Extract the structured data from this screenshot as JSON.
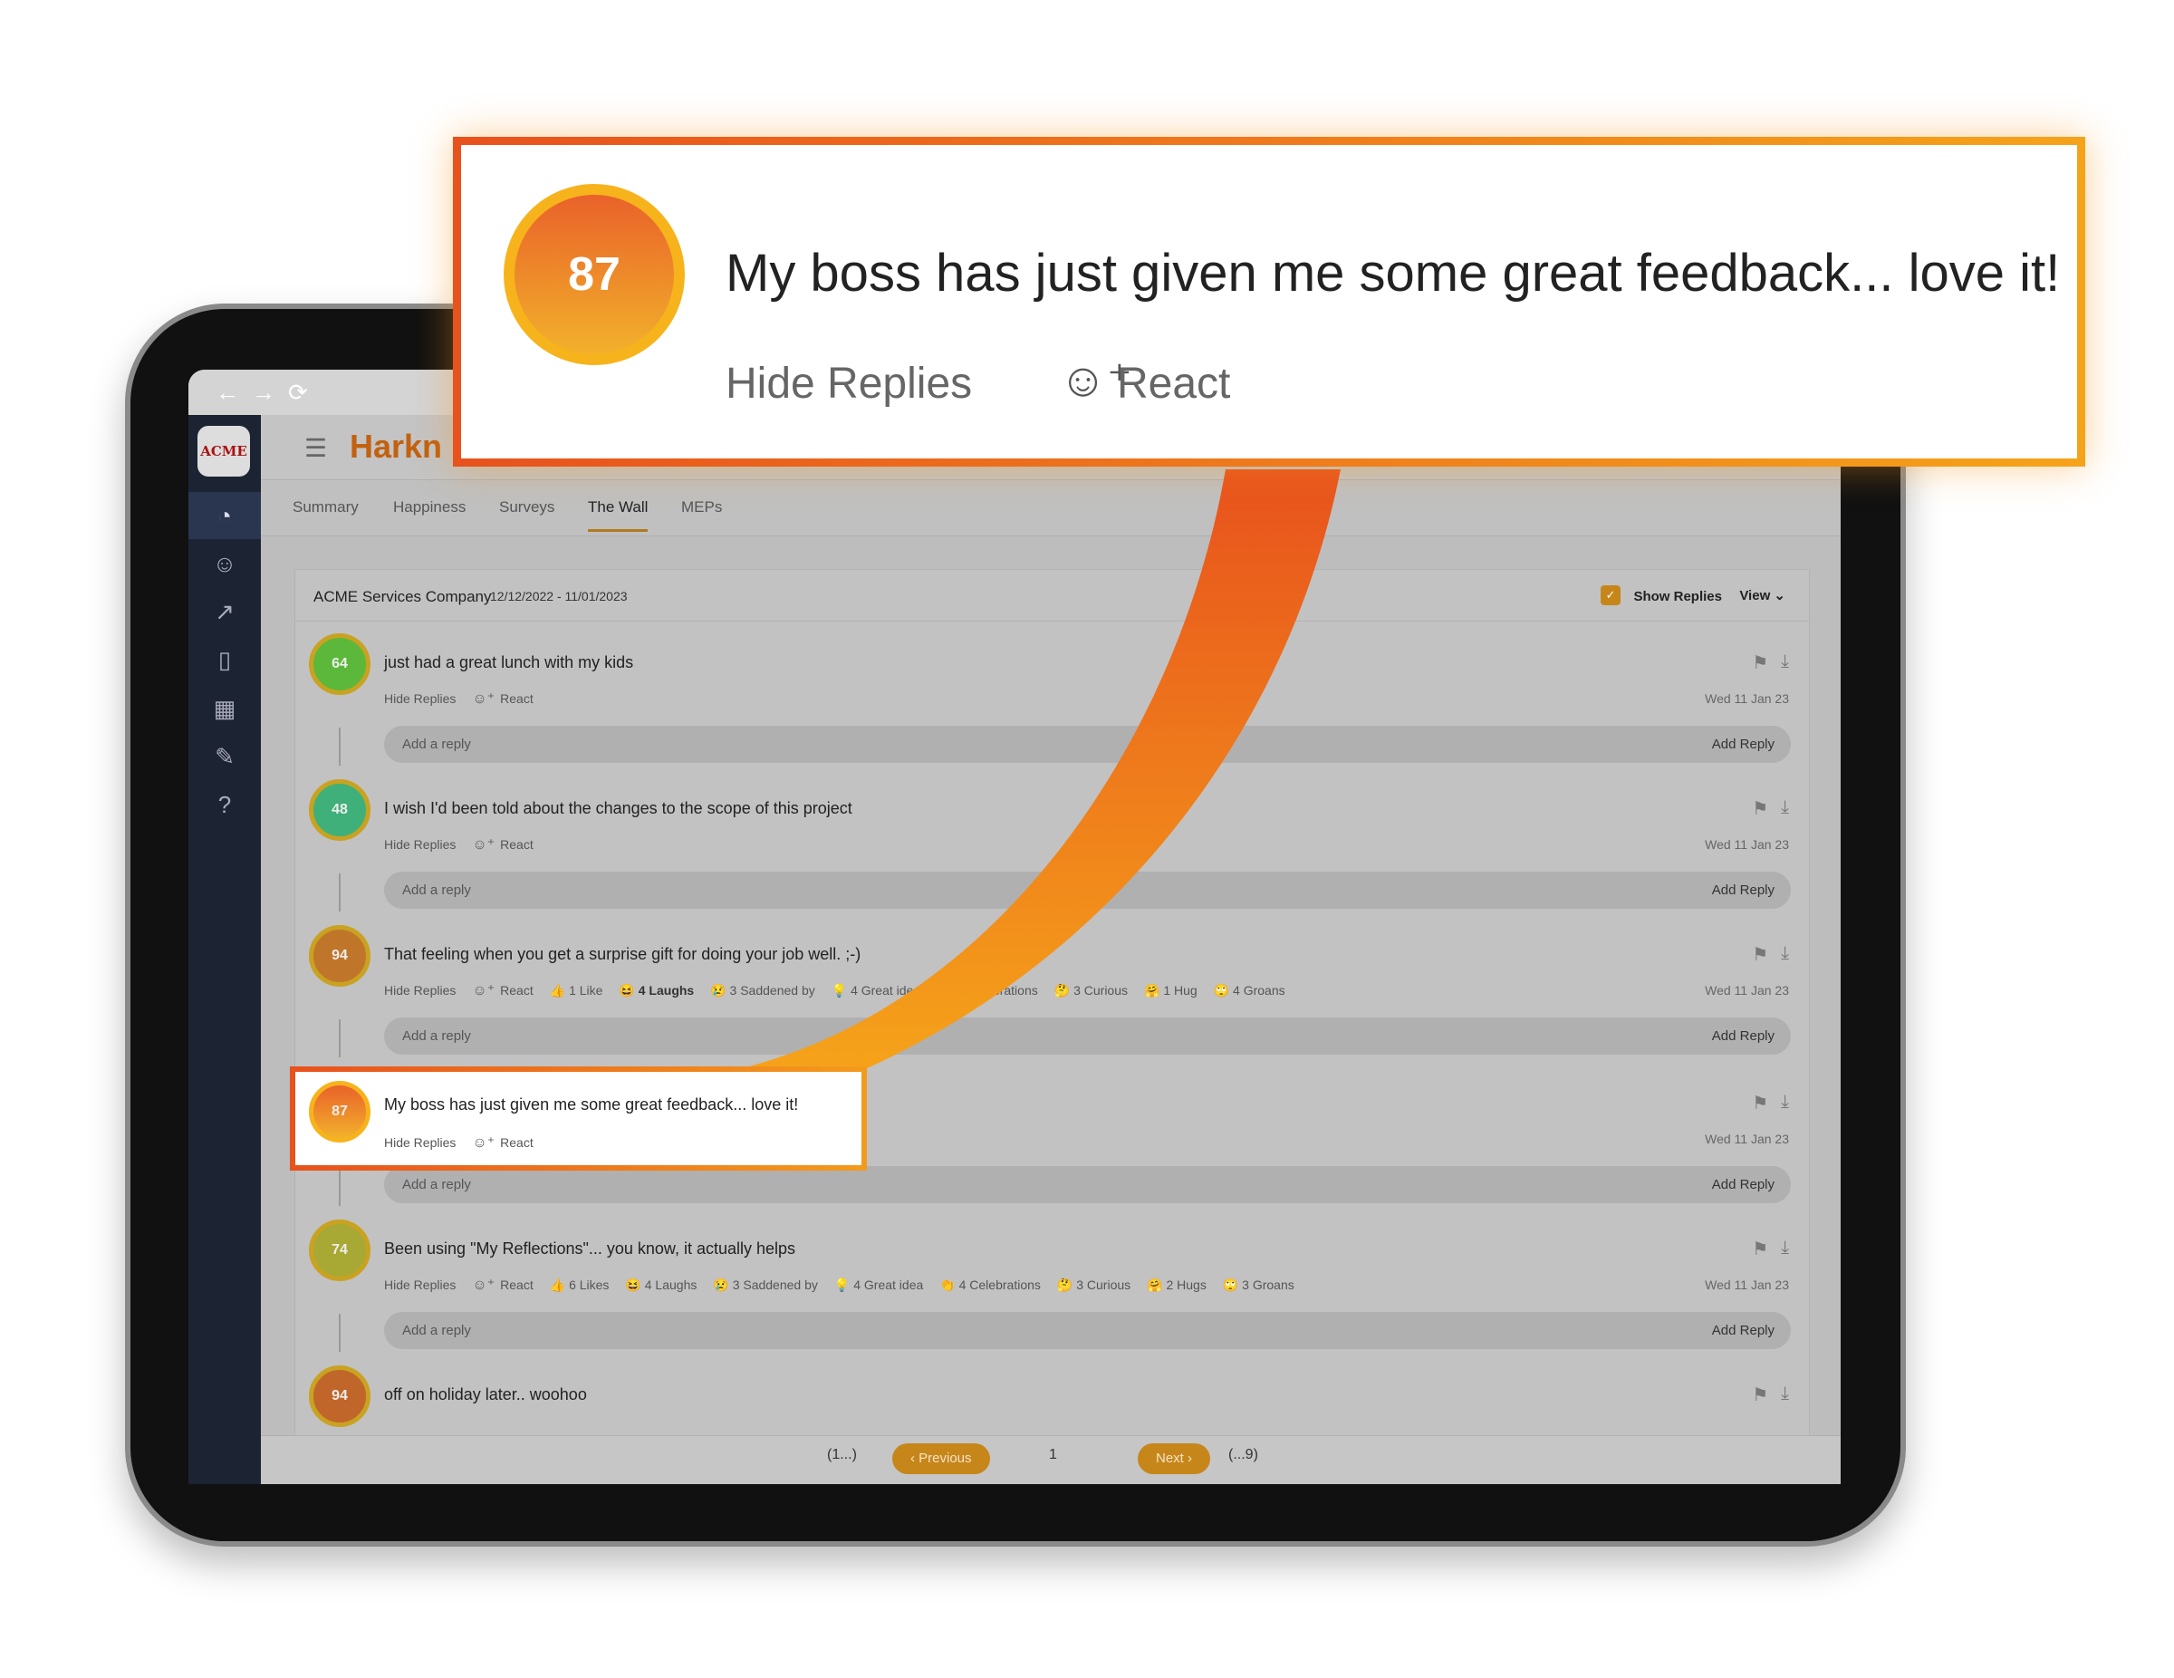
{
  "browser": {
    "back": "←",
    "forward": "→",
    "reload": "⟳"
  },
  "app": {
    "logo": "ACME",
    "brand": "Harkn"
  },
  "sidebar": {
    "icons": [
      "dashboard-icon",
      "chat-icon",
      "trend-icon",
      "book-icon",
      "org-chart-icon",
      "tools-icon",
      "help-icon"
    ]
  },
  "tabs": [
    {
      "label": "Summary"
    },
    {
      "label": "Happiness"
    },
    {
      "label": "Surveys"
    },
    {
      "label": "The Wall",
      "active": true
    },
    {
      "label": "MEPs"
    }
  ],
  "wall": {
    "company": "ACME Services Company",
    "date_range": "12/12/2022 - 11/01/2023",
    "show_replies_label": "Show Replies",
    "show_replies_checked": true,
    "view_label": "View",
    "posts": [
      {
        "score": "64",
        "text": "just had a great lunch with my kids",
        "hide": "Hide Replies",
        "react": "React",
        "date": "Wed 11 Jan 23",
        "reply_placeholder": "Add a reply",
        "reply_button": "Add Reply",
        "color": "#5cb83a",
        "reactions": []
      },
      {
        "score": "48",
        "text": "I wish I'd been told about the changes to the scope of this project",
        "hide": "Hide Replies",
        "react": "React",
        "date": "Wed 11 Jan 23",
        "reply_placeholder": "Add a reply",
        "reply_button": "Add Reply",
        "color": "#3fb07a",
        "reactions": []
      },
      {
        "score": "94",
        "text": "That feeling when you get a surprise gift for doing your job well. ;-)",
        "hide": "Hide Replies",
        "react": "React",
        "date": "Wed 11 Jan 23",
        "reply_placeholder": "Add a reply",
        "reply_button": "Add Reply",
        "color": "#c0762a",
        "reactions": [
          {
            "icon": "👍",
            "label": "1 Like"
          },
          {
            "icon": "😆",
            "label": "4 Laughs",
            "bold": true
          },
          {
            "icon": "😢",
            "label": "3 Saddened by"
          },
          {
            "icon": "💡",
            "label": "4 Great idea"
          },
          {
            "icon": "👏",
            "label": "4 Celebrations"
          },
          {
            "icon": "🤔",
            "label": "3 Curious"
          },
          {
            "icon": "🤗",
            "label": "1 Hug"
          },
          {
            "icon": "🙄",
            "label": "4 Groans"
          }
        ]
      },
      {
        "score": "87",
        "text": "My boss has just given me some great feedback... love it!",
        "hide": "Hide Replies",
        "react": "React",
        "date": "Wed 11 Jan 23",
        "reply_placeholder": "Add a reply",
        "reply_button": "Add Reply",
        "color": "#e8843a",
        "highlighted": true,
        "reactions": []
      },
      {
        "score": "74",
        "text": "Been using \"My Reflections\"... you know, it actually helps",
        "hide": "Hide Replies",
        "react": "React",
        "date": "Wed 11 Jan 23",
        "reply_placeholder": "Add a reply",
        "reply_button": "Add Reply",
        "color": "#a8a834",
        "reactions": [
          {
            "icon": "👍",
            "label": "6 Likes"
          },
          {
            "icon": "😆",
            "label": "4 Laughs"
          },
          {
            "icon": "😢",
            "label": "3 Saddened by"
          },
          {
            "icon": "💡",
            "label": "4 Great idea"
          },
          {
            "icon": "👏",
            "label": "4 Celebrations"
          },
          {
            "icon": "🤔",
            "label": "3 Curious"
          },
          {
            "icon": "🤗",
            "label": "2 Hugs"
          },
          {
            "icon": "🙄",
            "label": "3 Groans"
          }
        ]
      },
      {
        "score": "94",
        "text": "off on holiday later.. woohoo",
        "color": "#c0662a",
        "reactions": []
      }
    ]
  },
  "pagination": {
    "first": "(1...)",
    "previous": "‹ Previous",
    "current": "1",
    "next": "Next ›",
    "last": "(...9)"
  },
  "callout": {
    "score": "87",
    "text": "My boss has just given me some great feedback... love it!",
    "hide": "Hide Replies",
    "react": "React"
  },
  "colors": {
    "accent": "#c7861a",
    "highlight_start": "#e8521d",
    "highlight_end": "#f5a31a",
    "sidebar": "#1c2433"
  }
}
